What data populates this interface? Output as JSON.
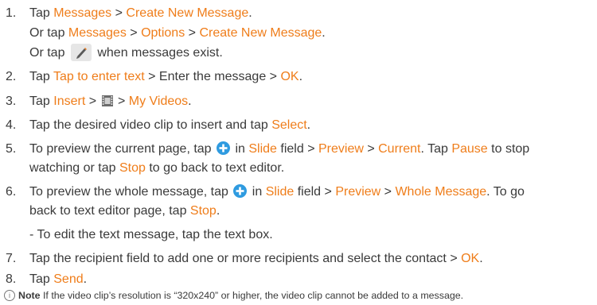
{
  "steps": [
    {
      "num": "1.",
      "a": "Tap ",
      "b": "Messages",
      "c": " > ",
      "d": "Create New Message",
      "e": "."
    },
    {
      "or1": "Or tap ",
      "or2": "Messages",
      "or3": " > ",
      "or4": "Options",
      "or5": " > ",
      "or6": "Create New Message",
      "or7": "."
    },
    {
      "pen1": "Or tap ",
      "pen2": " when messages exist."
    },
    {
      "num": "2.",
      "a": "Tap ",
      "b": "Tap to enter text",
      "c": " > Enter the message > ",
      "d": "OK",
      "e": "."
    },
    {
      "num": "3.",
      "a": "Tap ",
      "b": "Insert",
      "c": " > ",
      "c2": " > ",
      "d": "My Videos",
      "e": "."
    },
    {
      "num": "4.",
      "a": "Tap the desired video clip to insert and tap ",
      "b": "Select",
      "c": "."
    },
    {
      "num": "5.",
      "a": "To preview the current page, tap ",
      "a2": " in ",
      "b": "Slide",
      "c": " field > ",
      "d": "Preview",
      "e": " > ",
      "f": "Current",
      "g": ". Tap ",
      "h": "Pause",
      "i": " to stop",
      "l2a": "watching or tap ",
      "l2b": "Stop",
      "l2c": " to go back to text editor."
    },
    {
      "num": "6.",
      "a": "To preview the whole message, tap ",
      "a2": " in ",
      "b": "Slide",
      "c": " field > ",
      "d": "Preview",
      "e": " > ",
      "f": "Whole Message",
      "g": ". To go",
      "l2a": "back to text editor page, tap ",
      "l2b": "Stop",
      "l2c": "."
    },
    {
      "sub": "- To edit the text message, tap the text box."
    },
    {
      "num": "7.",
      "a": "Tap the recipient field to add one or more recipients and select the contact > ",
      "b": "OK",
      "c": "."
    },
    {
      "num": "8.",
      "a": "Tap ",
      "b": "Send",
      "c": "."
    }
  ],
  "note": {
    "icon": "info-icon",
    "label": "Note",
    "text": " If the video clip’s resolution is “320x240” or higher, the video clip cannot be added to a message."
  },
  "colors": {
    "highlight": "#ef7d1a",
    "text": "#3a3a3a",
    "plus_icon": "#2f9be0"
  }
}
